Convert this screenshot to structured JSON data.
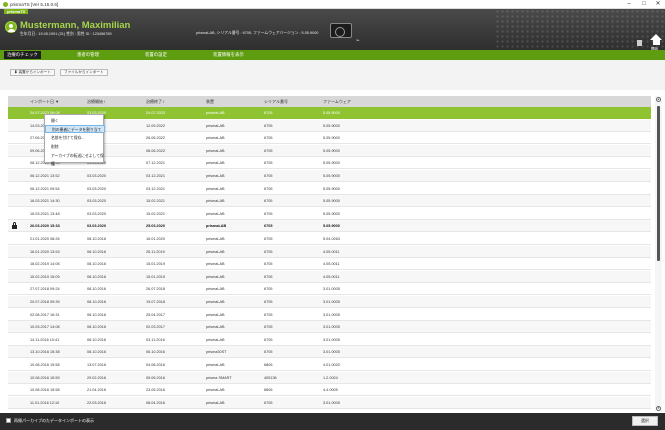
{
  "window": {
    "title": "prismaTS [Ver 5.15.0.6]",
    "minimize": "–",
    "maximize": "□",
    "close": "✕"
  },
  "header": {
    "brand": "prismaTS",
    "patient_name": "Mustermann, Maximilian",
    "patient_info": "生年月日 : 19.05.1991 (31)   性別 : 男性   ID : 123456789",
    "device_info": "prismaLAB,  シリアル番号 :  6705,  ファームウェアバージョン :  5.05.9000",
    "report_label": "",
    "home_label": "開始",
    "colors": {
      "accent": "#7fb51c",
      "header_bg": "#3a3a3a",
      "selected_row": "#8fc332"
    }
  },
  "tabs": [
    {
      "label": "治療のチェック",
      "active": true
    },
    {
      "label": "患者の管理",
      "active": false
    },
    {
      "label": "装置の設定",
      "active": false
    },
    {
      "label": "装置情報を表示",
      "active": false
    }
  ],
  "toolbar": {
    "import_device": "装置からインポート",
    "import_file": "ファイルからインポート"
  },
  "table": {
    "columns": [
      "インポート日 ▼",
      "治療開始 \\",
      "治療終了 /",
      "装置",
      "シリアル番号",
      "ファームウェア"
    ],
    "rows": [
      [
        "24.07.2023 06:08",
        "03.03.2020",
        "24.07.2023",
        "prismaLAB",
        "6705",
        "5.05.9000"
      ],
      [
        "14.03.2022 ...",
        "",
        "12.09.2022",
        "prismaLAB",
        "6705",
        "5.05.9000"
      ],
      [
        "27.06.2022 ...",
        "",
        "26.06.2022",
        "prismaLAB",
        "6705",
        "5.05.9000"
      ],
      [
        "09.06.2022 ...",
        "",
        "08.06.2022",
        "prismaLAB",
        "6705",
        "5.05.9000"
      ],
      [
        "08.12.2021 14:03",
        "03.03.2020",
        "07.12.2021",
        "prismaLAB",
        "6705",
        "5.05.9000"
      ],
      [
        "06.12.2021 13:52",
        "03.03.2020",
        "03.12.2021",
        "prismaLAB",
        "6705",
        "5.05.9000"
      ],
      [
        "06.12.2021 09:54",
        "03.03.2020",
        "03.12.2021",
        "prismaLAB",
        "6705",
        "5.05.9000"
      ],
      [
        "16.03.2021 14:30",
        "03.03.2020",
        "15.02.2021",
        "prismaLAB",
        "6705",
        "5.05.9000"
      ],
      [
        "16.03.2021 13:48",
        "03.03.2020",
        "15.02.2021",
        "prismaLAB",
        "6705",
        "5.05.9000"
      ],
      [
        "26.03.2020 15:33",
        "03.03.2020",
        "25.03.2020",
        "prismaLAB",
        "6705",
        "5.05.9000"
      ],
      [
        "21.01.2020 08:26",
        "08.10.2016",
        "16.01.2020",
        "prismaLAB",
        "6705",
        "5.04.0263"
      ],
      [
        "16.01.2020 13:53",
        "08.10.2016",
        "25.11.2019",
        "prismaLAB",
        "6705",
        "4.05.0011"
      ],
      [
        "18.02.2019 14:06",
        "08.10.2016",
        "15.01.2019",
        "prismaLAB",
        "6705",
        "4.05.0011"
      ],
      [
        "15.02.2019 15:09",
        "08.10.2016",
        "15.01.2019",
        "prismaLAB",
        "6705",
        "4.05.0011"
      ],
      [
        "27.07.2018 09:24",
        "08.10.2016",
        "26.07.2018",
        "prismaLAB",
        "6705",
        "3.01.0005"
      ],
      [
        "20.07.2018 09:39",
        "08.10.2016",
        "19.07.2018",
        "prismaLAB",
        "6705",
        "3.01.0005"
      ],
      [
        "02.08.2017 16:31",
        "08.10.2016",
        "25.04.2017",
        "prismaLAB",
        "6705",
        "3.01.0005"
      ],
      [
        "10.03.2017 14:08",
        "08.10.2016",
        "02.03.2017",
        "prismaLAB",
        "6705",
        "3.01.0005"
      ],
      [
        "14.11.2016 10:41",
        "08.10.2016",
        "03.11.2016",
        "prismaLAB",
        "6705",
        "3.01.0005"
      ],
      [
        "13.10.2016 15:38",
        "08.10.2016",
        "06.10.2016",
        "prisma30ST",
        "6705",
        "3.01.0005"
      ],
      [
        "10.08.2016 15:58",
        "13.07.2016",
        "04.08.2016",
        "prismaLAB",
        "6806",
        "4.01.0020"
      ],
      [
        "10.08.2016 15:59",
        "29.02.2016",
        "05.06.2016",
        "prisma SMART",
        "405136",
        "1.2.0024"
      ],
      [
        "10.08.2016 15:58",
        "21.04.2016",
        "23.05.2016",
        "prismaLAB",
        "6806",
        "4.4.0005"
      ],
      [
        "11.01.2016 12:10",
        "22.03.2016",
        "08.04.2016",
        "prismaLAB",
        "6705",
        "3.01.0005"
      ]
    ],
    "selected_row": 0,
    "locked_row": 9
  },
  "context_menu": {
    "items": [
      "開く",
      "別の患者にデータを割り当て",
      "名前を付けて保存...",
      "削除",
      "アーカイブの転送にせよして保護"
    ],
    "highlighted": 1
  },
  "footer": {
    "checkbox_label": "再帰パーカイブのたデータインポートの表示",
    "select_button": "選択"
  }
}
